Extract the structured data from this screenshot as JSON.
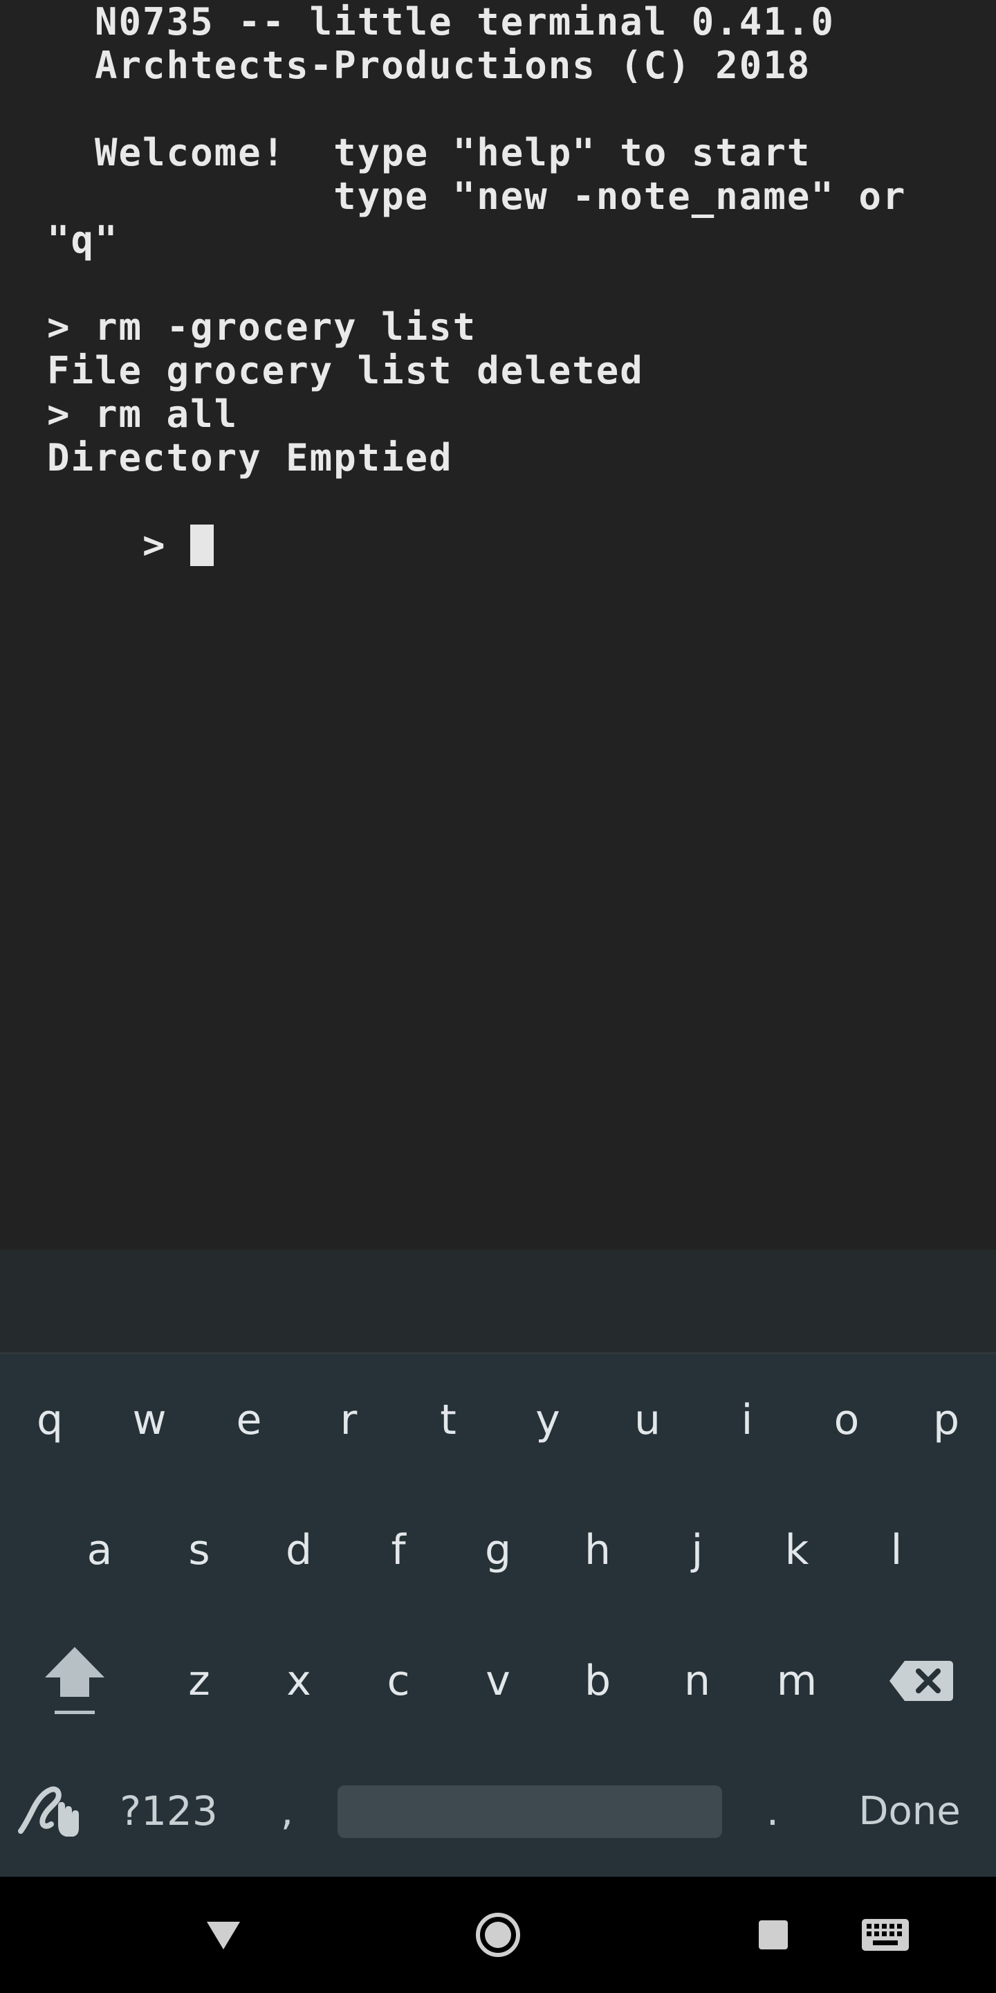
{
  "terminal": {
    "lines": [
      "  N0735 -- little terminal 0.41.0",
      "  Archtects-Productions (C) 2018",
      "",
      "  Welcome!  type \"help\" to start",
      "            type \"new -note_name\" or",
      "\"q\"",
      "",
      "> rm -grocery list",
      "File grocery list deleted",
      "> rm all",
      "Directory Emptied"
    ],
    "prompt": "> "
  },
  "keyboard": {
    "row1": [
      "q",
      "w",
      "e",
      "r",
      "t",
      "y",
      "u",
      "i",
      "o",
      "p"
    ],
    "row2": [
      "a",
      "s",
      "d",
      "f",
      "g",
      "h",
      "j",
      "k",
      "l"
    ],
    "row3": [
      "z",
      "x",
      "c",
      "v",
      "b",
      "n",
      "m"
    ],
    "symbols_label": "?123",
    "comma": ",",
    "period": ".",
    "done_label": "Done",
    "shift_icon": "shift-arrow-icon",
    "backspace_icon": "backspace-icon",
    "handwriting_icon": "handwriting-icon"
  },
  "navbar": {
    "back_icon": "back-triangle-icon",
    "home_icon": "home-circle-icon",
    "recents_icon": "recents-square-icon",
    "keyboard_icon": "keyboard-switch-icon"
  },
  "colors": {
    "terminal_bg": "#222222",
    "terminal_text": "#e9e9e9",
    "keyboard_bg": "#263238",
    "key_text": "#e3e7ea",
    "navbar_bg": "#000000"
  }
}
